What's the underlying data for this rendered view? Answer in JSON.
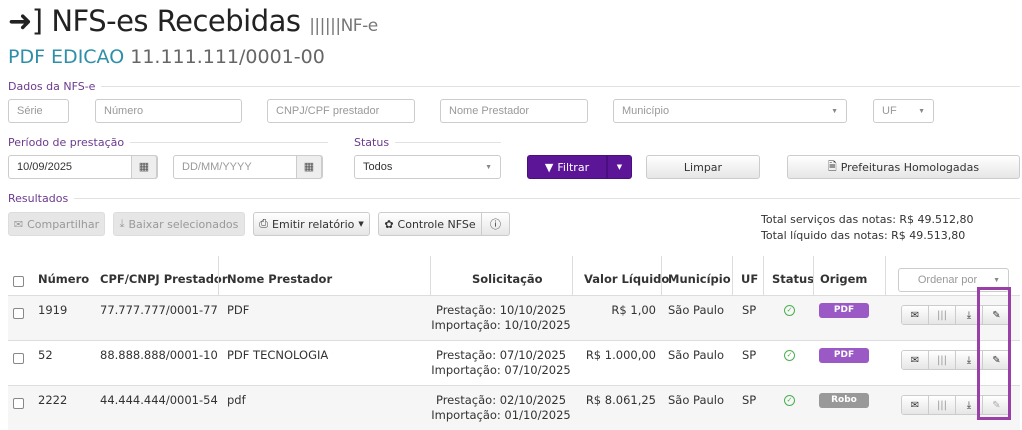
{
  "header": {
    "title": "NFS-es Recebidas",
    "subtitle": "NF-e",
    "company_name": "PDF EDICAO",
    "company_cnpj": "11.111.111/0001-00"
  },
  "filters": {
    "section_dados": "Dados da NFS-e",
    "serie_placeholder": "Série",
    "numero_placeholder": "Número",
    "cnpj_placeholder": "CNPJ/CPF prestador",
    "nome_placeholder": "Nome Prestador",
    "municipio_placeholder": "Município",
    "uf_placeholder": "UF",
    "section_periodo": "Período de prestação",
    "date_from": "10/09/2025",
    "date_to_placeholder": "DD/MM/YYYY",
    "section_status": "Status",
    "status_value": "Todos",
    "filtrar": "Filtrar",
    "limpar": "Limpar",
    "prefeituras": "Prefeituras Homologadas"
  },
  "results": {
    "section": "Resultados",
    "compartilhar": "Compartilhar",
    "baixar": "Baixar selecionados",
    "emitir": "Emitir relatório",
    "controle": "Controle NFSe",
    "total_servicos": "Total serviços das notas: R$ 49.512,80",
    "total_liquido": "Total líquido das notas: R$ 49.513,80",
    "order_placeholder": "Ordenar por"
  },
  "table": {
    "headers": [
      "Número",
      "CPF/CNPJ Prestador",
      "Nome Prestador",
      "Solicitação",
      "Valor Líquido",
      "Município",
      "UF",
      "Status",
      "Origem"
    ],
    "rows": [
      {
        "numero": "1919",
        "cnpj": "77.777.777/0001-77",
        "nome": "PDF",
        "prestacao": "Prestação: 10/10/2025",
        "importacao": "Importação: 10/10/2025",
        "valor": "R$ 1,00",
        "municipio": "São Paulo",
        "uf": "SP",
        "origem": "PDF"
      },
      {
        "numero": "52",
        "cnpj": "88.888.888/0001-10",
        "nome": "PDF TECNOLOGIA",
        "prestacao": "Prestação: 07/10/2025",
        "importacao": "Importação: 07/10/2025",
        "valor": "R$ 1.000,00",
        "municipio": "São Paulo",
        "uf": "SP",
        "origem": "PDF"
      },
      {
        "numero": "2222",
        "cnpj": "44.444.444/0001-54",
        "nome": "pdf",
        "prestacao": "Prestação: 02/10/2025",
        "importacao": "Importação: 01/10/2025",
        "valor": "R$ 8.061,25",
        "municipio": "São Paulo",
        "uf": "SP",
        "origem": "Robo"
      }
    ]
  },
  "colors": {
    "accent": "#5b1596",
    "badge_pdf": "#9b59c6",
    "badge_robo": "#999999",
    "highlight": "#9b3fa8"
  }
}
